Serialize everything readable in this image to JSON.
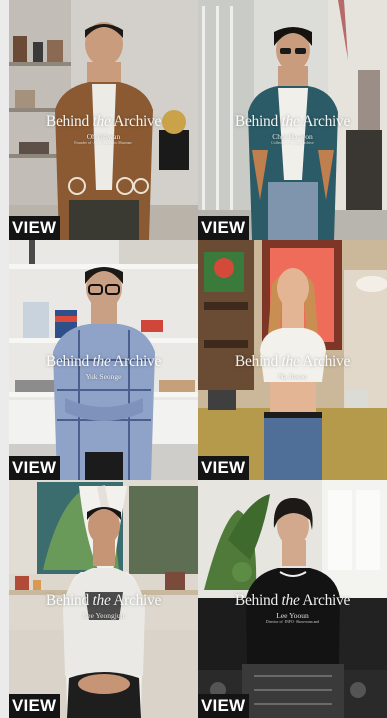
{
  "series_title": {
    "before": "Behind ",
    "italic": "the",
    "after": " Archive"
  },
  "cta_label": "VIEW",
  "tiles": [
    {
      "name": "Oh Inhwan",
      "desc": "Founder of ·Art in Aesthetic Museum·"
    },
    {
      "name": "Choi Ha-won",
      "desc": "Collector of vintage archive"
    },
    {
      "name": "Yuk Seonge",
      "desc": ""
    },
    {
      "name": "Na Jiwoo",
      "desc": ""
    },
    {
      "name": "Lee Yeongjun",
      "desc": ""
    },
    {
      "name": "Lee Yooun",
      "desc": "Director of ·INFO· Showroom and"
    }
  ],
  "colors": {
    "cta_bg": "#141414",
    "cta_text": "#ffffff",
    "page_bg": "#ebebeb"
  }
}
